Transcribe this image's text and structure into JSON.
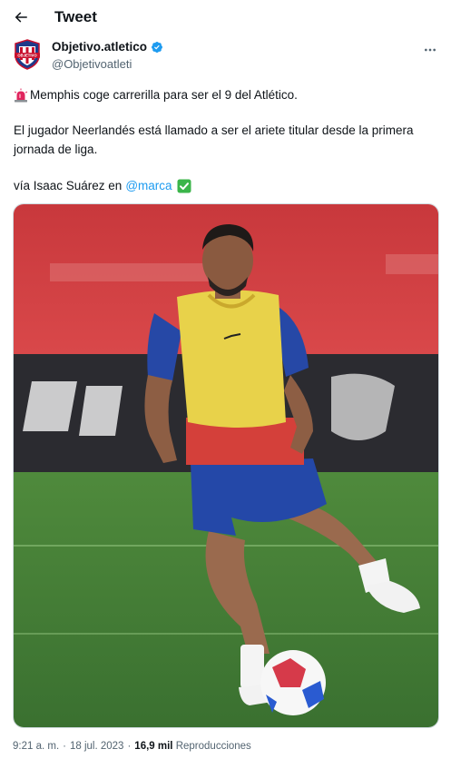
{
  "header": {
    "title": "Tweet"
  },
  "author": {
    "name": "Objetivo.atletico",
    "handle": "@Objetivoatleti",
    "avatar_text": "OBJETIVO"
  },
  "tweet": {
    "line1": "Memphis coge carrerilla para ser el 9 del Atlético.",
    "line2": "El jugador Neerlandés está llamado a ser el ariete titular desde la primera jornada de liga.",
    "via_prefix": "vía Isaac Suárez en",
    "mention": "@marca"
  },
  "meta": {
    "time": "9:21 a. m.",
    "date": "18 jul. 2023",
    "views_count": "16,9 mil",
    "views_label": "Reproducciones"
  },
  "colors": {
    "accent": "#1d9bf0",
    "secondary_text": "#536471",
    "check_green": "#3bb54a",
    "siren_red": "#e0245e"
  }
}
